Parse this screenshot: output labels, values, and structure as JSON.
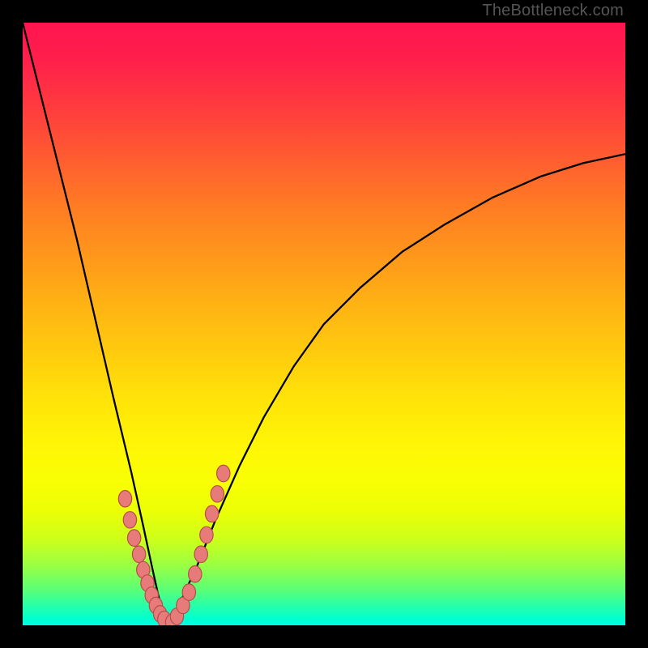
{
  "watermark": "TheBottleneck.com",
  "colors": {
    "frame": "#000000",
    "curve": "#000000",
    "bead_fill": "#e77b79",
    "bead_stroke": "#b94c4a",
    "gradient_top": "#ff144f",
    "gradient_bottom": "#00ffe6"
  },
  "chart_data": {
    "type": "line",
    "title": "",
    "xlabel": "",
    "ylabel": "",
    "categories": [],
    "description": "Asymmetric V-shaped bottleneck curve on a vertical red→yellow→green gradient. Minimum (0) near x≈0.24 of plot width. Left branch rises steeply to ~1.0 at x=0; right branch rises more gradually to ~0.78 at x=1. Clustered pink beads sit on both branches near the bottom of the V.",
    "x_range": [
      0,
      1
    ],
    "y_range": [
      0,
      1
    ],
    "series": [
      {
        "name": "left-branch",
        "x": [
          0.0,
          0.03,
          0.06,
          0.09,
          0.12,
          0.15,
          0.18,
          0.2,
          0.215,
          0.225,
          0.235,
          0.24
        ],
        "values": [
          1.0,
          0.88,
          0.76,
          0.64,
          0.51,
          0.38,
          0.255,
          0.165,
          0.095,
          0.05,
          0.015,
          0.0
        ]
      },
      {
        "name": "right-branch",
        "x": [
          0.24,
          0.26,
          0.29,
          0.32,
          0.36,
          0.4,
          0.45,
          0.5,
          0.56,
          0.63,
          0.7,
          0.78,
          0.86,
          0.93,
          1.0
        ],
        "values": [
          0.0,
          0.035,
          0.1,
          0.175,
          0.265,
          0.345,
          0.43,
          0.5,
          0.56,
          0.62,
          0.665,
          0.71,
          0.745,
          0.767,
          0.782
        ]
      }
    ],
    "beads_left": [
      [
        0.17,
        0.21
      ],
      [
        0.178,
        0.175
      ],
      [
        0.185,
        0.145
      ],
      [
        0.193,
        0.118
      ],
      [
        0.2,
        0.092
      ],
      [
        0.207,
        0.07
      ],
      [
        0.214,
        0.05
      ],
      [
        0.221,
        0.033
      ],
      [
        0.228,
        0.019
      ],
      [
        0.235,
        0.01
      ]
    ],
    "beads_right": [
      [
        0.248,
        0.005
      ],
      [
        0.256,
        0.015
      ],
      [
        0.266,
        0.033
      ],
      [
        0.276,
        0.055
      ],
      [
        0.286,
        0.085
      ],
      [
        0.296,
        0.118
      ],
      [
        0.305,
        0.15
      ],
      [
        0.314,
        0.185
      ],
      [
        0.323,
        0.218
      ],
      [
        0.333,
        0.252
      ]
    ],
    "bead_radius_rel": 0.011
  }
}
